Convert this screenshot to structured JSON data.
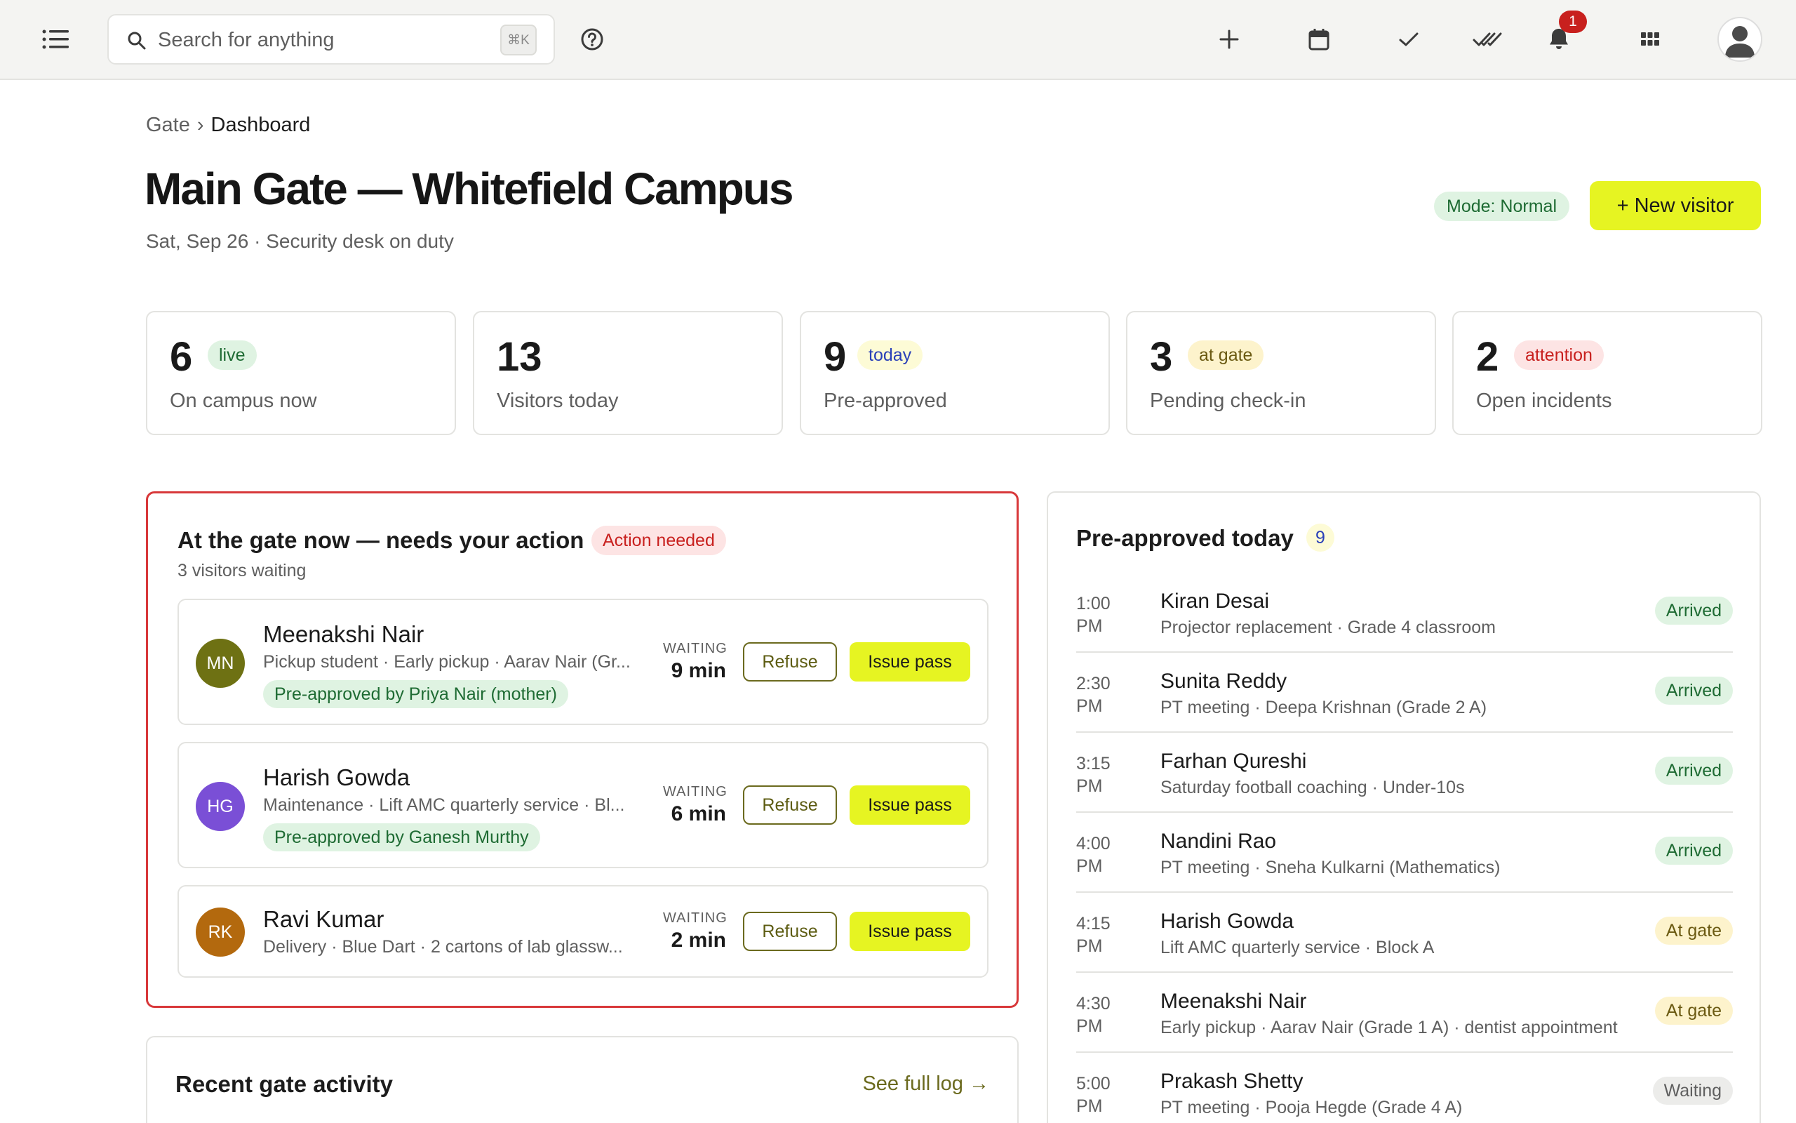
{
  "header": {
    "search_placeholder": "Search for anything",
    "search_shortcut": "⌘K",
    "notification_count": "1",
    "icons": [
      "menu-icon",
      "search-icon",
      "help-icon",
      "plus-icon",
      "calendar-icon",
      "check-icon",
      "double-check-icon",
      "bell-icon",
      "apps-grid-icon",
      "user-avatar-icon"
    ]
  },
  "breadcrumb": {
    "root": "Gate",
    "separator": "›",
    "current": "Dashboard"
  },
  "page": {
    "title": "Main Gate — Whitefield Campus",
    "subtitle": "Sat, Sep 26 · Security desk on duty",
    "mode": "Mode: Normal",
    "new_visitor": "+ New visitor"
  },
  "stats": [
    {
      "value": "6",
      "tag": "live",
      "label": "On campus now"
    },
    {
      "value": "13",
      "tag": "",
      "label": "Visitors today"
    },
    {
      "value": "9",
      "tag": "today",
      "label": "Pre-approved"
    },
    {
      "value": "3",
      "tag": "at gate",
      "label": "Pending check-in"
    },
    {
      "value": "2",
      "tag": "attention",
      "label": "Open incidents"
    }
  ],
  "action_panel": {
    "title": "At the gate now — needs your action",
    "badge": "Action needed",
    "subtitle": "3 visitors waiting",
    "refuse_label": "Refuse",
    "issue_label": "Issue pass",
    "waiting_label": "WAITING",
    "visitors": [
      {
        "initials": "MN",
        "name": "Meenakshi Nair",
        "detail": "Pickup student · Early pickup · Aarav Nair (Gr...",
        "preapproved": "Pre-approved by Priya Nair (mother)",
        "waiting": "9 min"
      },
      {
        "initials": "HG",
        "name": "Harish Gowda",
        "detail": "Maintenance · Lift AMC quarterly service · Bl...",
        "preapproved": "Pre-approved by Ganesh Murthy",
        "waiting": "6 min"
      },
      {
        "initials": "RK",
        "name": "Ravi Kumar",
        "detail": "Delivery · Blue Dart · 2 cartons of lab glassw...",
        "preapproved": "",
        "waiting": "2 min"
      }
    ]
  },
  "recent": {
    "title": "Recent gate activity",
    "link": "See full log →"
  },
  "preapproved": {
    "title": "Pre-approved today",
    "count": "9",
    "rows": [
      {
        "time1": "1:00",
        "time2": "PM",
        "name": "Kiran Desai",
        "detail": "Projector replacement · Grade 4 classroom",
        "status": "Arrived"
      },
      {
        "time1": "2:30",
        "time2": "PM",
        "name": "Sunita Reddy",
        "detail": "PT meeting · Deepa Krishnan (Grade 2 A)",
        "status": "Arrived"
      },
      {
        "time1": "3:15",
        "time2": "PM",
        "name": "Farhan Qureshi",
        "detail": "Saturday football coaching · Under-10s",
        "status": "Arrived"
      },
      {
        "time1": "4:00",
        "time2": "PM",
        "name": "Nandini Rao",
        "detail": "PT meeting · Sneha Kulkarni (Mathematics)",
        "status": "Arrived"
      },
      {
        "time1": "4:15",
        "time2": "PM",
        "name": "Harish Gowda",
        "detail": "Lift AMC quarterly service · Block A",
        "status": "At gate"
      },
      {
        "time1": "4:30",
        "time2": "PM",
        "name": "Meenakshi Nair",
        "detail": "Early pickup · Aarav Nair (Grade 1 A) · dentist appointment",
        "status": "At gate"
      },
      {
        "time1": "5:00",
        "time2": "PM",
        "name": "Prakash Shetty",
        "detail": "PT meeting · Pooja Hegde (Grade 4 A)",
        "status": "Waiting"
      }
    ]
  },
  "colors": {
    "accent": "#e6f422",
    "alert": "#d8383a",
    "success_bg": "#dff3e2",
    "success_fg": "#1e6b33",
    "warning_bg": "#fdf3cc",
    "neutral_bg": "#ececea"
  }
}
